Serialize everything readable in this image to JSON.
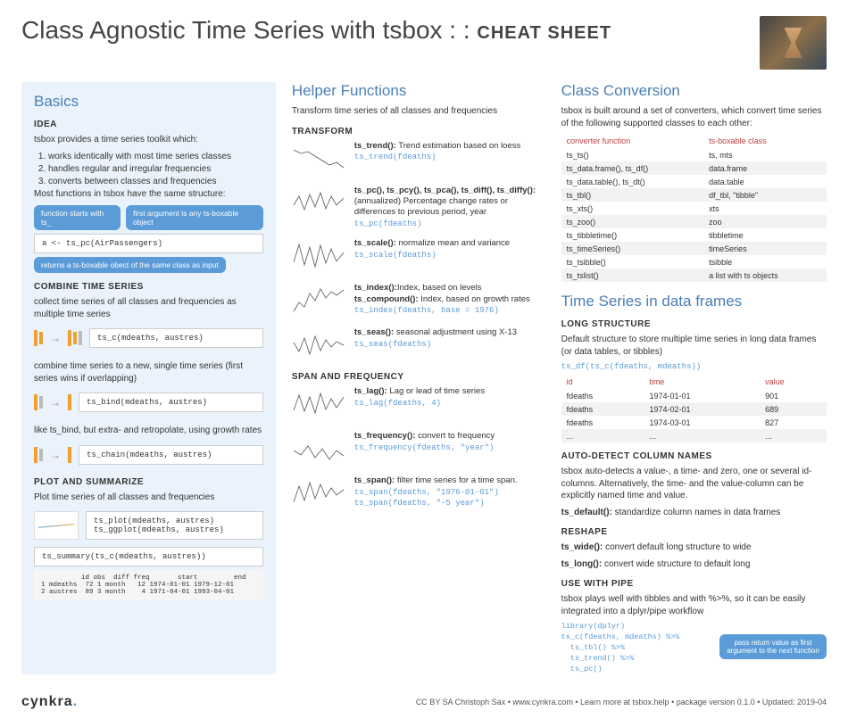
{
  "header": {
    "title": "Class Agnostic Time Series with tsbox : :",
    "subtitle": "CHEAT SHEET"
  },
  "basics": {
    "heading": "Basics",
    "idea_h": "IDEA",
    "idea_intro": "tsbox provides a time series toolkit which:",
    "idea_1": "works identically with most time series classes",
    "idea_2": "handles regular and irregular frequencies",
    "idea_3": "converts between classes and frequencies",
    "idea_outro": "Most functions in tsbox have the same structure:",
    "bubble1": "function starts with ts_",
    "bubble2": "first argument is any ts-boxable object",
    "code_ex": "a <- ts_pc(AirPassengers)",
    "bubble3": "returns a ts-boxable obect of the same class as input",
    "combine_h": "COMBINE TIME SERIES",
    "combine_p1": "collect time series of all classes and frequencies as multiple time series",
    "combine_c1": "ts_c(mdeaths, austres)",
    "combine_p2": "combine time series to a new, single time series (first series wins if overlapping)",
    "combine_c2": "ts_bind(mdeaths, austres)",
    "combine_p3": "like ts_bind, but extra- and retropolate, using growth rates",
    "combine_c3": "ts_chain(mdeaths, austres)",
    "plot_h": "PLOT AND SUMMARIZE",
    "plot_p": "Plot time series of all classes and frequencies",
    "plot_c1": "ts_plot(mdeaths, austres)\nts_ggplot(mdeaths, austres)",
    "plot_c2": "ts_summary(ts_c(mdeaths, austres))",
    "summary_out": "          id obs  diff freq       start         end\n1 mdeaths  72 1 month   12 1974-01-01 1979-12-01\n2 austres  89 3 month    4 1971-04-01 1993-04-01"
  },
  "helpers": {
    "heading": "Helper Functions",
    "intro": "Transform time series of all classes and frequencies",
    "transform_h": "TRANSFORM",
    "items": [
      {
        "title": "ts_trend():",
        "desc": " Trend estimation based on loess",
        "code": "ts_trend(fdeaths)"
      },
      {
        "title": "ts_pc(), ts_pcy(), ts_pca(), ts_diff(), ts_diffy():",
        "desc": " (annualized) Percentage change rates or differences to previous period, year",
        "code": "ts_pc(fdeaths)"
      },
      {
        "title": "ts_scale():",
        "desc": " normalize mean and variance",
        "code": "ts_scale(fdeaths)"
      },
      {
        "title": "ts_index():",
        "desc": "Index, based on levels",
        "title2": "ts_compound():",
        "desc2": " Index, based on growth rates",
        "code": "ts_index(fdeaths, base = 1976)"
      },
      {
        "title": "ts_seas():",
        "desc": " seasonal adjustment using X-13",
        "code": "ts_seas(fdeaths)"
      }
    ],
    "span_h": "SPAN AND FREQUENCY",
    "span_items": [
      {
        "title": "ts_lag():",
        "desc": " Lag or lead of time series",
        "code": "ts_lag(fdeaths, 4)"
      },
      {
        "title": "ts_frequency():",
        "desc": " convert to frequency",
        "code": "ts_frequency(fdeaths, \"year\")"
      },
      {
        "title": "ts_span():",
        "desc": " filter time series for a time span.",
        "code": "ts_span(fdeaths, \"1976-01-01\")\nts_span(fdeaths, \"-5 year\")"
      }
    ]
  },
  "conversion": {
    "heading": "Class Conversion",
    "intro": "tsbox is built around a set of converters, which convert time series of the following supported classes to each other:",
    "th1": "converter function",
    "th2": "ts-boxable class",
    "rows": [
      [
        "ts_ts()",
        "ts, mts"
      ],
      [
        "ts_data.frame(), ts_df()",
        "data.frame"
      ],
      [
        "ts_data.table(), ts_dt()",
        "data.table"
      ],
      [
        "ts_tbl()",
        "df_tbl, \"tibble\""
      ],
      [
        "ts_xts()",
        "xts"
      ],
      [
        "ts_zoo()",
        "zoo"
      ],
      [
        "ts_tibbletime()",
        "tibbletime"
      ],
      [
        "ts_timeSeries()",
        "timeSeries"
      ],
      [
        "ts_tsibble()",
        "tsibble"
      ],
      [
        "ts_tslist()",
        "a list with ts objects"
      ]
    ]
  },
  "dataframes": {
    "heading": "Time Series in data frames",
    "long_h": "LONG STRUCTURE",
    "long_p": "Default structure to store multiple time series in long data frames (or data tables, or tibbles)",
    "long_code": "ts_df(ts_c(fdeaths, mdeaths))",
    "th_id": "id",
    "th_time": "time",
    "th_value": "value",
    "rows": [
      [
        "fdeaths",
        "1974-01-01",
        "901"
      ],
      [
        "fdeaths",
        "1974-02-01",
        "689"
      ],
      [
        "fdeaths",
        "1974-03-01",
        "827"
      ],
      [
        "...",
        "...",
        "..."
      ]
    ],
    "auto_h": "AUTO-DETECT COLUMN NAMES",
    "auto_p": "tsbox auto-detects a value-, a time- and zero, one or several id-columns. Alternatively, the time- and the value-column can be explicitly named time and value.",
    "auto_fn": "ts_default(): ",
    "auto_fn_d": "standardize column names in data frames",
    "reshape_h": "RESHAPE",
    "wide": "ts_wide(): ",
    "wide_d": "convert default long structure to wide",
    "long": "ts_long(): ",
    "long_d": "convert wide structure to default long",
    "pipe_h": "USE WITH PIPE",
    "pipe_p": "tsbox plays well with tibbles and with %>%, so it can be easily integrated into a dplyr/pipe workflow",
    "pipe_code": "library(dplyr)\nts_c(fdeaths, mdeaths) %>%\n  ts_tbl() %>%\n  ts_trend() %>%\n  ts_pc()",
    "pipe_bubble": "pass return value as first argument to the next function"
  },
  "footer": {
    "logo": "cynkra",
    "text": "CC BY SA Christoph Sax  •  www.cynkra.com  •  Learn more at tsbox.help  •  package version  0.1.0  •  Updated: 2019-04"
  }
}
